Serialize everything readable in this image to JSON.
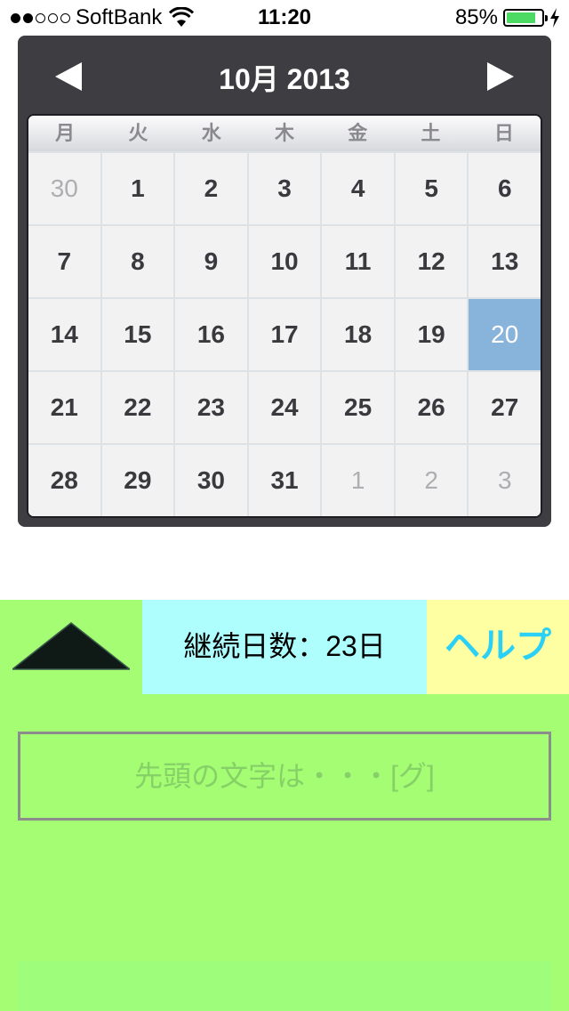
{
  "status_bar": {
    "carrier": "SoftBank",
    "signal_bars": 2,
    "time": "11:20",
    "battery_percent": "85%",
    "battery_level": 0.85
  },
  "calendar": {
    "month_title": "10月 2013",
    "weekdays": [
      "月",
      "火",
      "水",
      "木",
      "金",
      "土",
      "日"
    ],
    "weeks": [
      [
        {
          "d": "30",
          "o": true
        },
        {
          "d": "1"
        },
        {
          "d": "2"
        },
        {
          "d": "3"
        },
        {
          "d": "4"
        },
        {
          "d": "5"
        },
        {
          "d": "6"
        }
      ],
      [
        {
          "d": "7"
        },
        {
          "d": "8"
        },
        {
          "d": "9"
        },
        {
          "d": "10"
        },
        {
          "d": "11"
        },
        {
          "d": "12"
        },
        {
          "d": "13"
        }
      ],
      [
        {
          "d": "14"
        },
        {
          "d": "15"
        },
        {
          "d": "16"
        },
        {
          "d": "17"
        },
        {
          "d": "18"
        },
        {
          "d": "19"
        },
        {
          "d": "20",
          "s": true
        }
      ],
      [
        {
          "d": "21"
        },
        {
          "d": "22"
        },
        {
          "d": "23"
        },
        {
          "d": "24"
        },
        {
          "d": "25"
        },
        {
          "d": "26"
        },
        {
          "d": "27"
        }
      ],
      [
        {
          "d": "28"
        },
        {
          "d": "29"
        },
        {
          "d": "30"
        },
        {
          "d": "31"
        },
        {
          "d": "1",
          "o": true
        },
        {
          "d": "2",
          "o": true
        },
        {
          "d": "3",
          "o": true
        }
      ]
    ]
  },
  "toolbar": {
    "streak_text": "継続日数：23日",
    "help_label": "ヘルプ"
  },
  "hint": {
    "text": "先頭の文字は・・・[グ]"
  },
  "icons": {
    "prev": "triangle-left-icon",
    "next": "triangle-right-icon",
    "collapse": "triangle-up-icon",
    "wifi": "wifi-icon",
    "battery": "battery-icon",
    "charging": "bolt-icon"
  },
  "colors": {
    "panel_green": "#a5fd74",
    "streak_cyan": "#aefefe",
    "help_yellow": "#fefea2",
    "help_text": "#2ad0f5",
    "selected_day": "#88b4db",
    "calendar_frame": "#3d3d42"
  }
}
